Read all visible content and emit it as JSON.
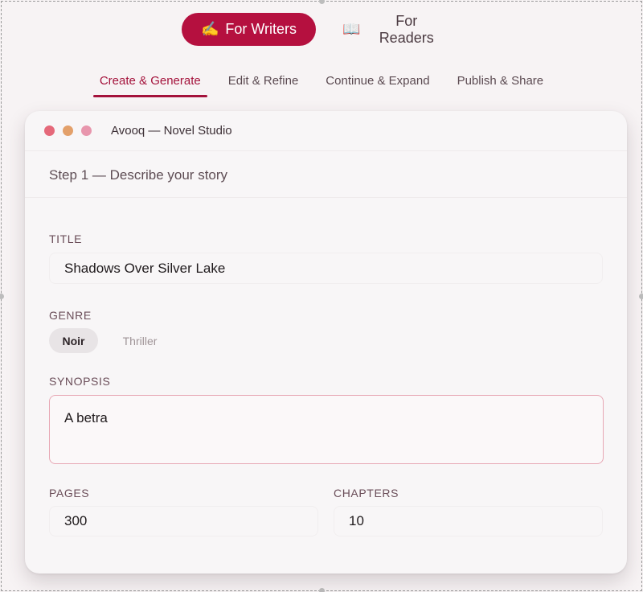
{
  "audience_toggle": {
    "writers": {
      "icon": "✍️",
      "icon_name": "writing-hand-icon",
      "label": "For Writers"
    },
    "readers": {
      "icon": "📖",
      "icon_name": "open-book-icon",
      "label": "For Readers"
    }
  },
  "subtabs": [
    {
      "label": "Create & Generate",
      "active": true
    },
    {
      "label": "Edit & Refine",
      "active": false
    },
    {
      "label": "Continue & Expand",
      "active": false
    },
    {
      "label": "Publish & Share",
      "active": false
    }
  ],
  "window": {
    "title": "Avooq — Novel Studio",
    "step_title": "Step 1 — Describe your story"
  },
  "form": {
    "title_label": "TITLE",
    "title_value": "Shadows Over Silver Lake",
    "genre_label": "GENRE",
    "genres": [
      {
        "label": "Noir",
        "selected": true
      },
      {
        "label": "Thriller",
        "selected": false
      }
    ],
    "synopsis_label": "SYNOPSIS",
    "synopsis_value": "A betra",
    "pages_label": "PAGES",
    "pages_value": "300",
    "chapters_label": "CHAPTERS",
    "chapters_value": "10"
  },
  "colors": {
    "accent": "#b5103f",
    "active_tab": "#a4123b",
    "synopsis_border": "#e7a7b4"
  }
}
